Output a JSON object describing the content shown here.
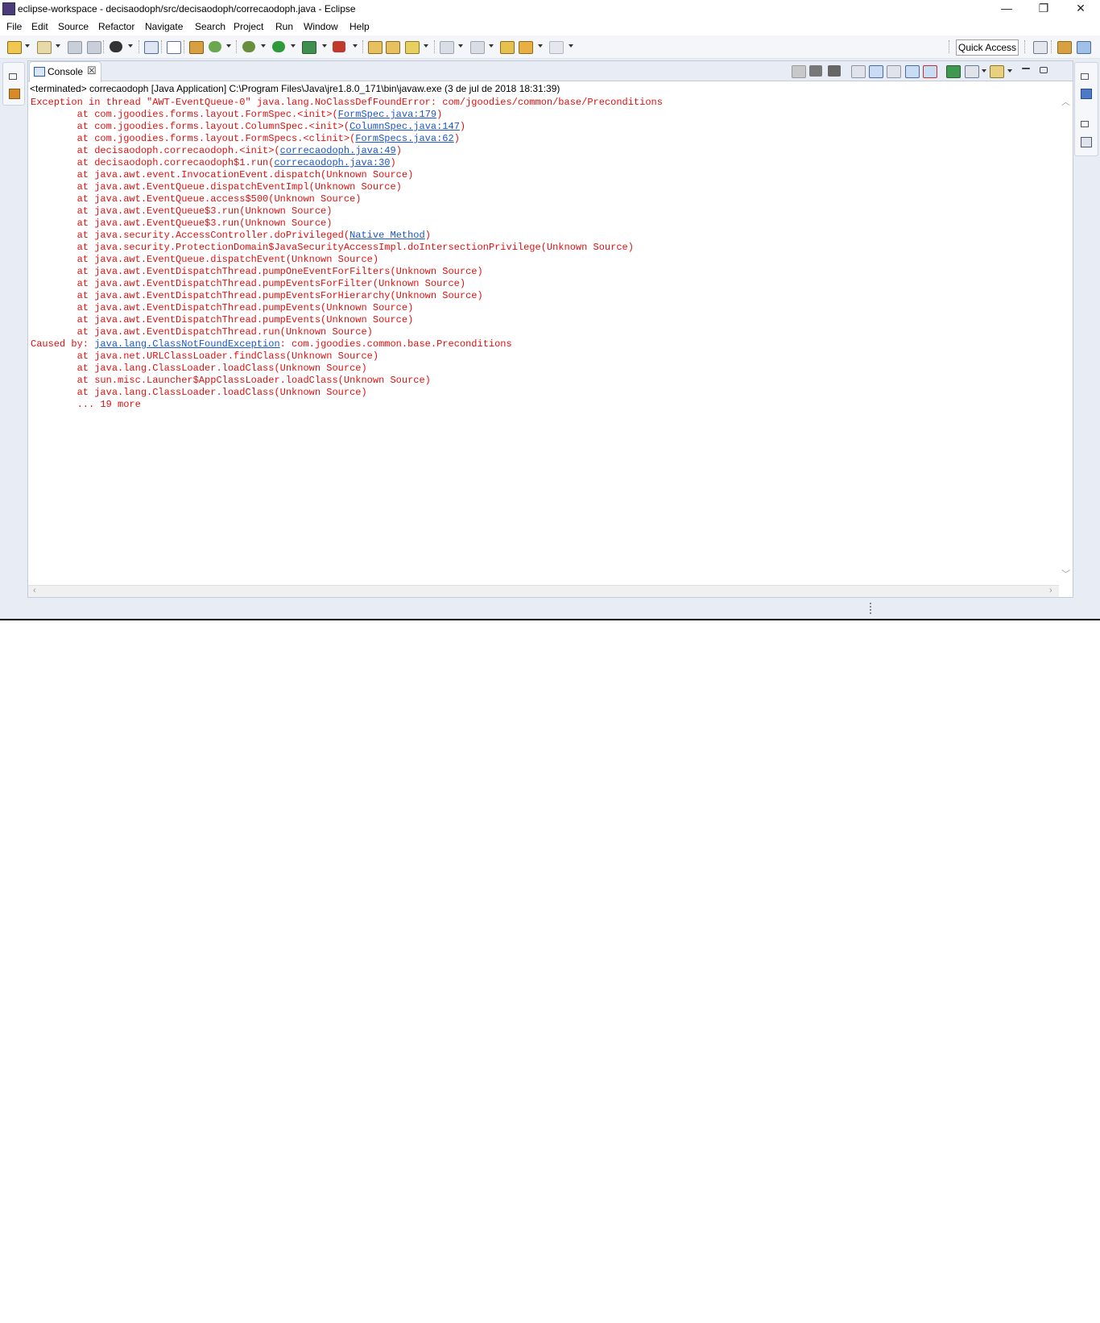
{
  "window": {
    "title": "eclipse-workspace - decisaodoph/src/decisaodoph/correcaodoph.java - Eclipse",
    "minimize": "—",
    "restore": "❐",
    "close": "✕"
  },
  "menu": [
    "File",
    "Edit",
    "Source",
    "Refactor",
    "Navigate",
    "Search",
    "Project",
    "Run",
    "Window",
    "Help"
  ],
  "toolbar": {
    "quick_access": "Quick Access"
  },
  "console": {
    "tab_label": "Console",
    "tab_close": "☒",
    "header": "<terminated> correcaodoph [Java Application] C:\\Program Files\\Java\\jre1.8.0_171\\bin\\javaw.exe (3 de jul de 2018 18:31:39)",
    "lines": [
      {
        "pre": "Exception in thread \"AWT-EventQueue-0\" java.lang.NoClassDefFoundError: com/jgoodies/common/base/Preconditions",
        "link": "",
        "post": ""
      },
      {
        "pre": "\tat com.jgoodies.forms.layout.FormSpec.<init>(",
        "link": "FormSpec.java:179",
        "post": ")"
      },
      {
        "pre": "\tat com.jgoodies.forms.layout.ColumnSpec.<init>(",
        "link": "ColumnSpec.java:147",
        "post": ")"
      },
      {
        "pre": "\tat com.jgoodies.forms.layout.FormSpecs.<clinit>(",
        "link": "FormSpecs.java:62",
        "post": ")"
      },
      {
        "pre": "\tat decisaodoph.correcaodoph.<init>(",
        "link": "correcaodoph.java:49",
        "post": ")"
      },
      {
        "pre": "\tat decisaodoph.correcaodoph$1.run(",
        "link": "correcaodoph.java:30",
        "post": ")"
      },
      {
        "pre": "\tat java.awt.event.InvocationEvent.dispatch(Unknown Source)",
        "link": "",
        "post": ""
      },
      {
        "pre": "\tat java.awt.EventQueue.dispatchEventImpl(Unknown Source)",
        "link": "",
        "post": ""
      },
      {
        "pre": "\tat java.awt.EventQueue.access$500(Unknown Source)",
        "link": "",
        "post": ""
      },
      {
        "pre": "\tat java.awt.EventQueue$3.run(Unknown Source)",
        "link": "",
        "post": ""
      },
      {
        "pre": "\tat java.awt.EventQueue$3.run(Unknown Source)",
        "link": "",
        "post": ""
      },
      {
        "pre": "\tat java.security.AccessController.doPrivileged(",
        "link": "Native Method",
        "post": ")"
      },
      {
        "pre": "\tat java.security.ProtectionDomain$JavaSecurityAccessImpl.doIntersectionPrivilege(Unknown Source)",
        "link": "",
        "post": ""
      },
      {
        "pre": "\tat java.awt.EventQueue.dispatchEvent(Unknown Source)",
        "link": "",
        "post": ""
      },
      {
        "pre": "\tat java.awt.EventDispatchThread.pumpOneEventForFilters(Unknown Source)",
        "link": "",
        "post": ""
      },
      {
        "pre": "\tat java.awt.EventDispatchThread.pumpEventsForFilter(Unknown Source)",
        "link": "",
        "post": ""
      },
      {
        "pre": "\tat java.awt.EventDispatchThread.pumpEventsForHierarchy(Unknown Source)",
        "link": "",
        "post": ""
      },
      {
        "pre": "\tat java.awt.EventDispatchThread.pumpEvents(Unknown Source)",
        "link": "",
        "post": ""
      },
      {
        "pre": "\tat java.awt.EventDispatchThread.pumpEvents(Unknown Source)",
        "link": "",
        "post": ""
      },
      {
        "pre": "\tat java.awt.EventDispatchThread.run(Unknown Source)",
        "link": "",
        "post": ""
      },
      {
        "pre": "Caused by: ",
        "link": "java.lang.ClassNotFoundException",
        "post": ": com.jgoodies.common.base.Preconditions"
      },
      {
        "pre": "\tat java.net.URLClassLoader.findClass(Unknown Source)",
        "link": "",
        "post": ""
      },
      {
        "pre": "\tat java.lang.ClassLoader.loadClass(Unknown Source)",
        "link": "",
        "post": ""
      },
      {
        "pre": "\tat sun.misc.Launcher$AppClassLoader.loadClass(Unknown Source)",
        "link": "",
        "post": ""
      },
      {
        "pre": "\tat java.lang.ClassLoader.loadClass(Unknown Source)",
        "link": "",
        "post": ""
      },
      {
        "pre": "\t... 19 more",
        "link": "",
        "post": ""
      }
    ]
  },
  "colors": {
    "error_text": "#e01010",
    "link_text": "#1a56c9"
  }
}
